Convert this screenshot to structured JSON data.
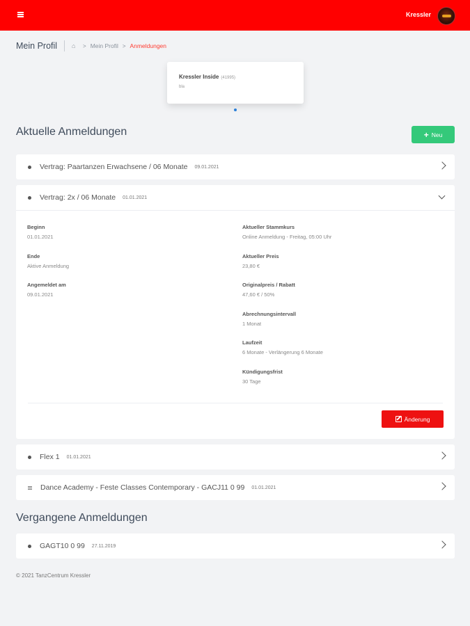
{
  "header": {
    "menu_icon": "hamburger-icon",
    "username": "Kressler",
    "brand_color": "#ff0000"
  },
  "breadcrumb": {
    "title": "Mein Profil",
    "home_icon": "home-icon",
    "link": "Mein Profil",
    "active": "Anmeldungen"
  },
  "studio": {
    "name": "Kressler Inside",
    "id": "(41995)",
    "sub": "bla"
  },
  "current": {
    "title": "Aktuelle Anmeldungen",
    "new_button": {
      "icon": "plus-icon",
      "label": "Neu"
    },
    "items": [
      {
        "title": "Vertrag: Paartanzen Erwachsene / 06 Monate",
        "date": "09.01.2021",
        "icon": "bullet-icon"
      },
      {
        "title": "Vertrag: 2x / 06 Monate",
        "date": "01.01.2021",
        "icon": "bullet-icon"
      },
      {
        "title": "Flex 1",
        "date": "01.01.2021",
        "icon": "bullet-icon"
      },
      {
        "title": "Dance Academy - Feste Classes Contemporary - GACJ11 0 99",
        "date": "01.01.2021",
        "icon": "list-icon"
      }
    ],
    "details": {
      "left": [
        {
          "label": "Beginn",
          "value": "01.01.2021"
        },
        {
          "label": "Ende",
          "value": "Aktive Anmeldung"
        },
        {
          "label": "Angemeldet am",
          "value": "09.01.2021"
        }
      ],
      "right": [
        {
          "label": "Aktueller Stammkurs",
          "value": "Online Anmeldung - Freitag, 05:00 Uhr"
        },
        {
          "label": "Aktueller Preis",
          "value": "23,80 €"
        },
        {
          "label": "Originalpreis / Rabatt",
          "value": "47,60 € / 50%"
        },
        {
          "label": "Abrechnungsintervall",
          "value": "1 Monat"
        },
        {
          "label": "Laufzeit",
          "value": "6 Monate - Verlängerung 6 Monate"
        },
        {
          "label": "Kündigungsfrist",
          "value": "30 Tage"
        }
      ],
      "change_button": {
        "icon": "edit-icon",
        "label": "Änderung"
      }
    }
  },
  "past": {
    "title": "Vergangene Anmeldungen",
    "items": [
      {
        "title": "GAGT10 0 99",
        "date": "27.11.2019",
        "icon": "bullet-icon"
      }
    ]
  },
  "footer": {
    "text": "© 2021 TanzCentrum Kressler"
  }
}
